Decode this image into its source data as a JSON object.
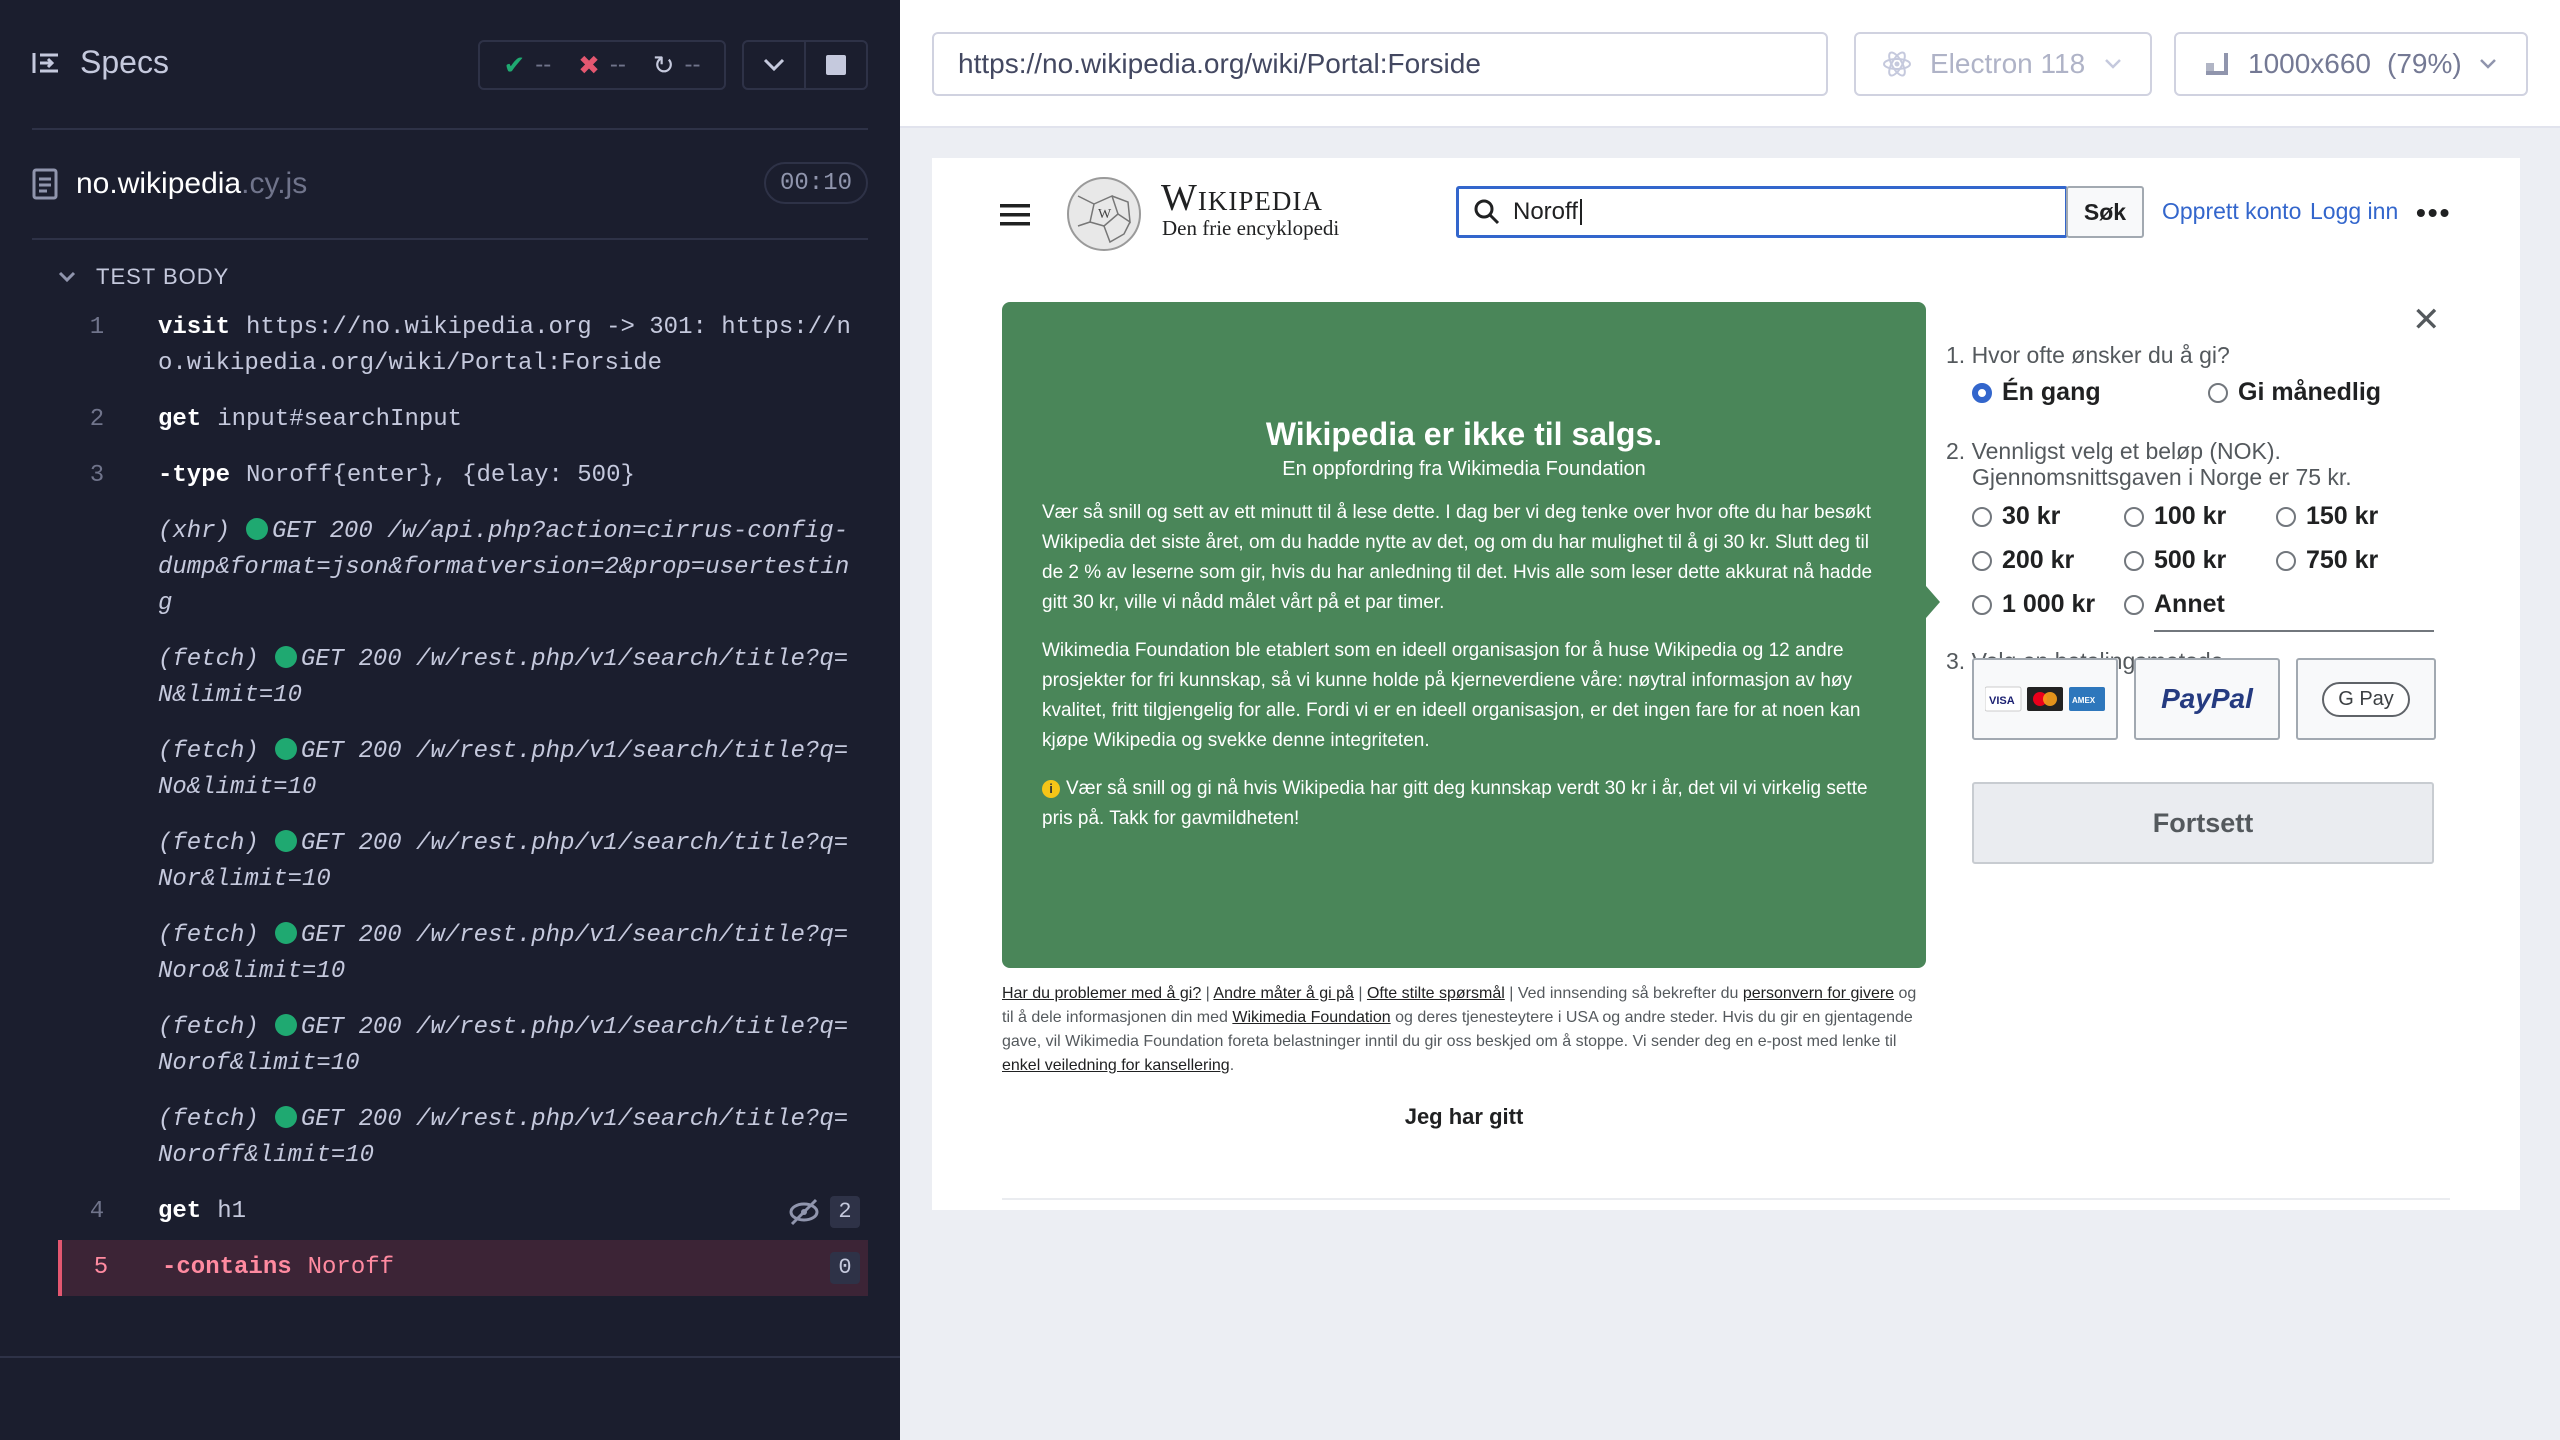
{
  "reporter": {
    "specs_label": "Specs",
    "stats": {
      "passed": "--",
      "failed": "--",
      "pending": "--"
    },
    "spec": {
      "name": "no.wikipedia",
      "ext": ".cy.js",
      "duration": "00:10"
    },
    "test_body_label": "TEST BODY",
    "commands": [
      {
        "num": "1",
        "name": "visit",
        "message": "https://no.wikipedia.org -> 301: https://no.wikipedia.org/wiki/Portal:Forside"
      },
      {
        "num": "2",
        "name": "get",
        "message": "input#searchInput"
      },
      {
        "num": "3",
        "name": "-type",
        "message": "Noroff{enter}, {delay: 500}"
      },
      {
        "type": "(xhr)",
        "text": "GET 200 /w/api.php?action=cirrus-config-dump&format=json&formatversion=2&prop=usertesting"
      },
      {
        "type": "(fetch)",
        "text": "GET 200 /w/rest.php/v1/search/title?q=N&limit=10"
      },
      {
        "type": "(fetch)",
        "text": "GET 200 /w/rest.php/v1/search/title?q=No&limit=10"
      },
      {
        "type": "(fetch)",
        "text": "GET 200 /w/rest.php/v1/search/title?q=Nor&limit=10"
      },
      {
        "type": "(fetch)",
        "text": "GET 200 /w/rest.php/v1/search/title?q=Noro&limit=10"
      },
      {
        "type": "(fetch)",
        "text": "GET 200 /w/rest.php/v1/search/title?q=Norof&limit=10"
      },
      {
        "type": "(fetch)",
        "text": "GET 200 /w/rest.php/v1/search/title?q=Noroff&limit=10"
      },
      {
        "num": "4",
        "name": "get",
        "message": "h1",
        "badge": "2"
      },
      {
        "num": "5",
        "name": "-contains",
        "message": "Noroff",
        "badge": "0"
      }
    ],
    "colors": {
      "bg": "#1b1e2e",
      "pass": "#1fa971",
      "fail": "#e45770"
    }
  },
  "aut_header": {
    "url": "https://no.wikipedia.org/wiki/Portal:Forside",
    "browser": "Electron 118",
    "viewport": "1000x660",
    "scale": "(79%)"
  },
  "wiki": {
    "wordmark": "Wikipedia",
    "tagline": "Den frie encyklopedi",
    "search_value": "Noroff",
    "search_button": "Søk",
    "create_account": "Opprett konto",
    "login": "Logg inn",
    "more": "•••",
    "banner": {
      "title": "Wikipedia er ikke til salgs.",
      "subtitle": "En oppfordring fra Wikimedia Foundation",
      "p1": "Vær så snill og sett av ett minutt til å lese dette. I dag ber vi deg tenke over hvor ofte du har besøkt Wikipedia det siste året, om du hadde nytte av det, og om du har mulighet til å gi 30 kr. Slutt deg til de 2 % av leserne som gir, hvis du har anledning til det. Hvis alle som leser dette akkurat nå hadde gitt 30 kr, ville vi nådd målet vårt på et par timer.",
      "p2": "Wikimedia Foundation ble etablert som en ideell organisasjon for å huse Wikipedia og 12 andre prosjekter for fri kunnskap, så vi kunne holde på kjerneverdiene våre: nøytral informasjon av høy kvalitet, fritt tilgjengelig for alle. Fordi vi er en ideell organisasjon, er det ingen fare for at noen kan kjøpe Wikipedia og svekke denne integriteten.",
      "p3": "Vær så snill og gi nå hvis Wikipedia har gitt deg kunnskap verdt 30 kr i år, det vil vi virkelig sette pris på. Takk for gavmildheten!",
      "color": "#4a8659"
    },
    "form": {
      "q1": "1.  Hvor ofte ønsker du å gi?",
      "freq_once": "Én gang",
      "freq_monthly": "Gi månedlig",
      "q2_line1": "2.  Vennligst velg et beløp (NOK).",
      "q2_line2": "Gjennomsnittsgaven i Norge er 75 kr.",
      "amounts": [
        "30 kr",
        "100 kr",
        "150 kr",
        "200 kr",
        "500 kr",
        "750 kr",
        "1 000 kr",
        "Annet"
      ],
      "q3": "3.  Velg en betalingsmetode",
      "paypal": "PayPal",
      "gpay": "G Pay",
      "continue": "Fortsett"
    },
    "footer": {
      "link1": "Har du problemer med å gi?",
      "link2": "Andre måter å gi på",
      "link3": "Ofte stilte spørsmål",
      "text1": " | Ved innsending så bekrefter du ",
      "link4": "personvern for givere",
      "text2": " og til å dele informasjonen din med ",
      "link5": "Wikimedia Foundation",
      "text3": " og deres tjenesteytere i USA og andre steder. Hvis du gir en gjentagende gave, vil Wikimedia Foundation foreta belastninger inntil du gir oss beskjed om å stoppe. Vi sender deg en e-post med lenke til ",
      "link6": "enkel veiledning for kansellering",
      "text4": "."
    },
    "already_gave": "Jeg har gitt"
  }
}
